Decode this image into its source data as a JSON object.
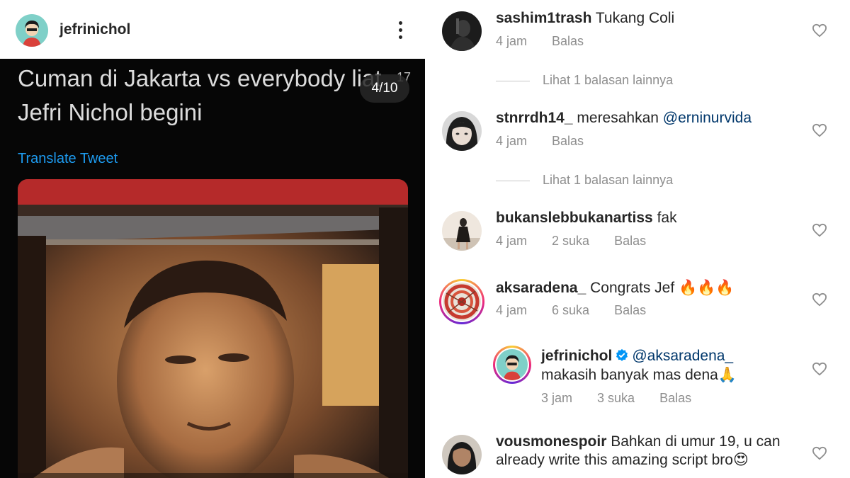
{
  "post": {
    "username": "jefrinichol",
    "more_icon": "more-vertical-icon",
    "tweet": {
      "text": "Cuman di Jakarta vs everybody liat Jefri Nichol begini",
      "time_fragment": "17",
      "translate_label": "Translate Tweet"
    },
    "slide_counter": "4/10"
  },
  "comments": [
    {
      "username": "sashim1trash",
      "text": "Tukang Coli",
      "time": "4 jam",
      "likes": "",
      "reply_label": "Balas",
      "view_replies": "Lihat 1 balasan lainnya"
    },
    {
      "username": "stnrrdh14_",
      "text": "meresahkan ",
      "mention": "@erninurvida",
      "time": "4 jam",
      "likes": "",
      "reply_label": "Balas",
      "view_replies": "Lihat 1 balasan lainnya"
    },
    {
      "username": "bukanslebbukanartiss",
      "text": "fak",
      "time": "4 jam",
      "likes": "2 suka",
      "reply_label": "Balas"
    },
    {
      "username": "aksaradena_",
      "text": "Congrats Jef ",
      "emoji": "🔥🔥🔥",
      "time": "4 jam",
      "likes": "6 suka",
      "reply_label": "Balas"
    },
    {
      "username": "jefrinichol",
      "mention": "@aksaradena_",
      "text": "makasih banyak mas dena",
      "emoji": "🙏",
      "time": "3 jam",
      "likes": "3 suka",
      "reply_label": "Balas",
      "verified": true
    },
    {
      "username": "vousmonespoir",
      "text": "Bahkan di umur 19, u can",
      "text_line2": "already write this amazing script bro",
      "emoji": "😍",
      "time": "",
      "likes": "",
      "reply_label": ""
    }
  ],
  "colors": {
    "link_blue": "#1d9bf0",
    "mention": "#00376b",
    "meta_gray": "#8e8e8e",
    "verified": "#0095f6"
  }
}
